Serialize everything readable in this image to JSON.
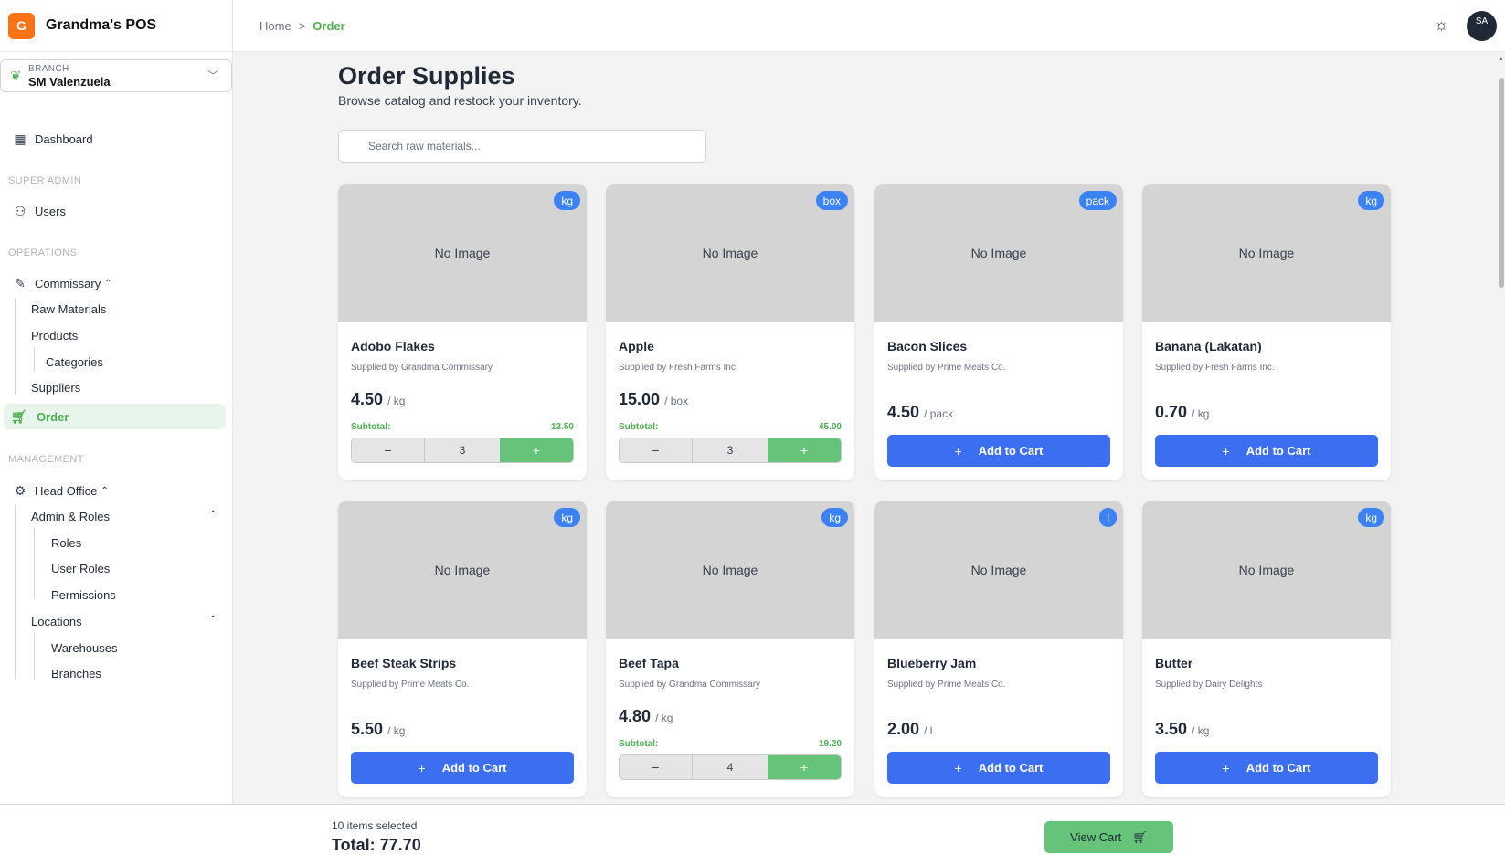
{
  "app": {
    "logo_letter": "G",
    "name": "Grandma's POS"
  },
  "branch": {
    "label": "BRANCH",
    "value": "SM Valenzuela"
  },
  "nav": {
    "dashboard": "Dashboard",
    "super_admin_label": "SUPER ADMIN",
    "users": "Users",
    "operations_label": "OPERATIONS",
    "commissary": "Commissary",
    "raw_materials": "Raw Materials",
    "products": "Products",
    "categories": "Categories",
    "suppliers": "Suppliers",
    "order": "Order",
    "management_label": "MANAGEMENT",
    "head_office": "Head Office",
    "admin_roles": "Admin & Roles",
    "roles": "Roles",
    "user_roles": "User Roles",
    "permissions": "Permissions",
    "locations": "Locations",
    "warehouses": "Warehouses",
    "branches": "Branches"
  },
  "breadcrumb": {
    "home": "Home",
    "current": "Order"
  },
  "header": {
    "avatar_initials": "SA"
  },
  "page": {
    "title": "Order Supplies",
    "subtitle": "Browse catalog and restock your inventory.",
    "search_placeholder": "Search raw materials..."
  },
  "labels": {
    "no_image": "No Image",
    "subtotal": "Subtotal:",
    "add_to_cart": "Add to Cart",
    "minus": "−",
    "plus": "+"
  },
  "products": [
    {
      "name": "Adobo Flakes",
      "supplier": "Supplied by Grandma Commissary",
      "price": "4.50",
      "unit": "kg",
      "per": "/ kg",
      "in_cart": true,
      "qty": "3",
      "subtotal": "13.50"
    },
    {
      "name": "Apple",
      "supplier": "Supplied by Fresh Farms Inc.",
      "price": "15.00",
      "unit": "box",
      "per": "/ box",
      "in_cart": true,
      "qty": "3",
      "subtotal": "45.00"
    },
    {
      "name": "Bacon Slices",
      "supplier": "Supplied by Prime Meats Co.",
      "price": "4.50",
      "unit": "pack",
      "per": "/ pack",
      "in_cart": false
    },
    {
      "name": "Banana (Lakatan)",
      "supplier": "Supplied by Fresh Farms Inc.",
      "price": "0.70",
      "unit": "kg",
      "per": "/ kg",
      "in_cart": false
    },
    {
      "name": "Beef Steak Strips",
      "supplier": "Supplied by Prime Meats Co.",
      "price": "5.50",
      "unit": "kg",
      "per": "/ kg",
      "in_cart": false
    },
    {
      "name": "Beef Tapa",
      "supplier": "Supplied by Grandma Commissary",
      "price": "4.80",
      "unit": "kg",
      "per": "/ kg",
      "in_cart": true,
      "qty": "4",
      "subtotal": "19.20"
    },
    {
      "name": "Blueberry Jam",
      "supplier": "Supplied by Prime Meats Co.",
      "price": "2.00",
      "unit": "l",
      "per": "/ l",
      "in_cart": false
    },
    {
      "name": "Butter",
      "supplier": "Supplied by Dairy Delights",
      "price": "3.50",
      "unit": "kg",
      "per": "/ kg",
      "in_cart": false
    }
  ],
  "footer": {
    "items_selected": "10 items selected",
    "total": "Total: 77.70",
    "view_cart": "View Cart"
  }
}
